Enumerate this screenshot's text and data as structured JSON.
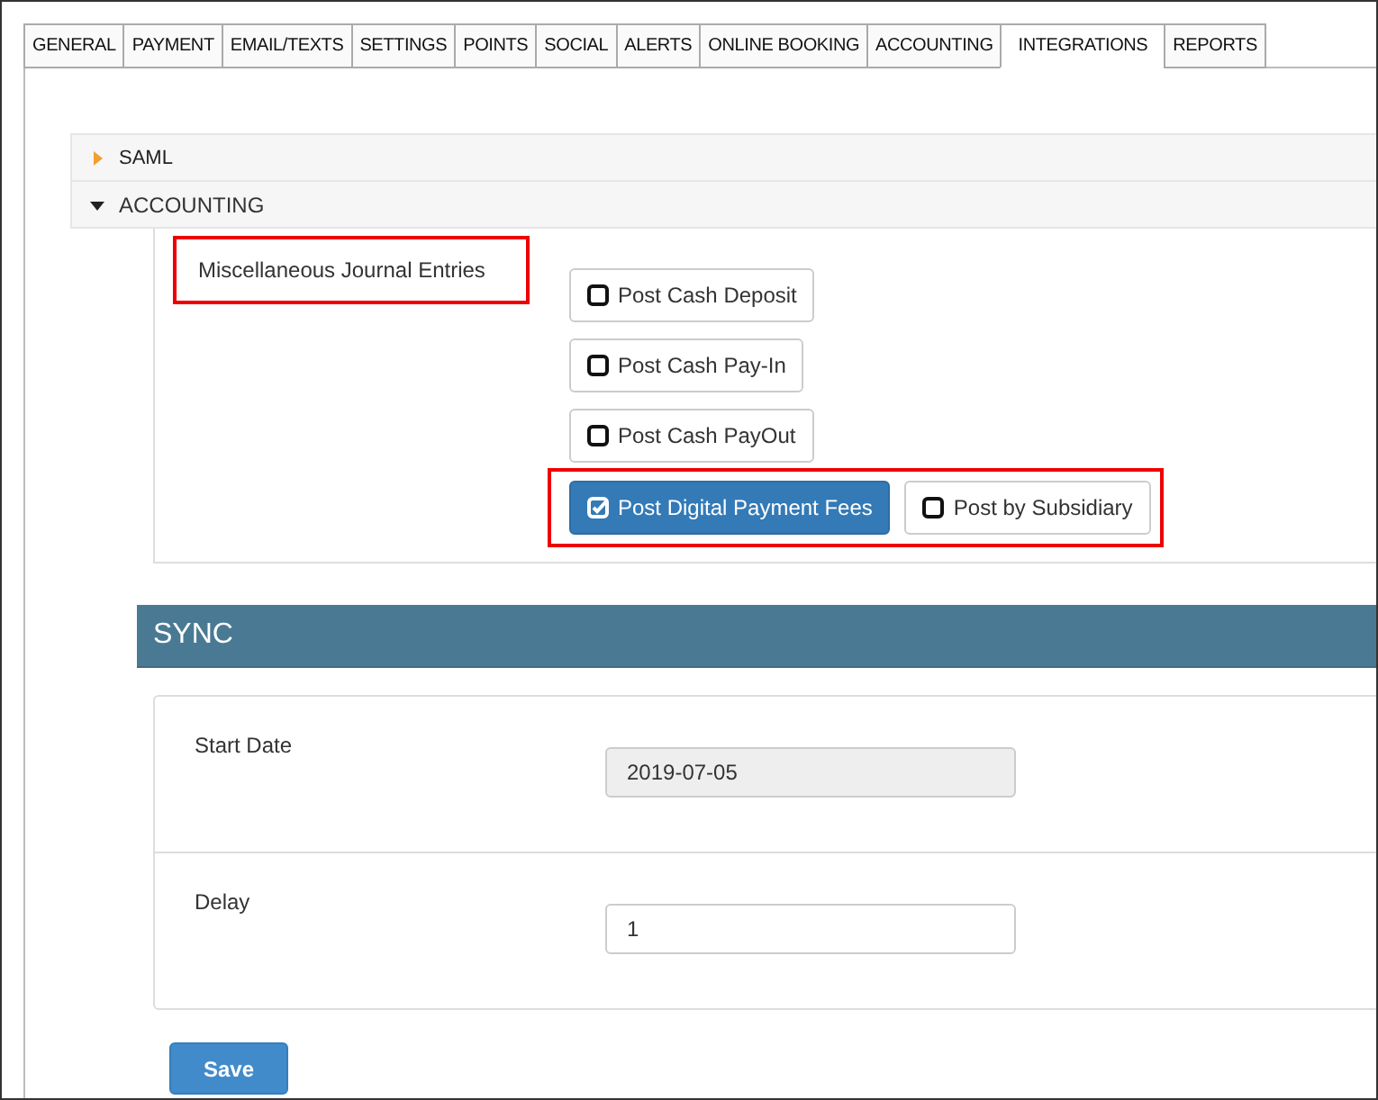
{
  "tabs": [
    {
      "label": "GENERAL",
      "selected": false
    },
    {
      "label": "PAYMENT",
      "selected": false
    },
    {
      "label": "EMAIL/TEXTS",
      "selected": false
    },
    {
      "label": "SETTINGS",
      "selected": false
    },
    {
      "label": "POINTS",
      "selected": false
    },
    {
      "label": "SOCIAL",
      "selected": false
    },
    {
      "label": "ALERTS",
      "selected": false
    },
    {
      "label": "ONLINE BOOKING",
      "selected": false
    },
    {
      "label": "ACCOUNTING",
      "selected": false
    },
    {
      "label": "INTEGRATIONS",
      "selected": true
    },
    {
      "label": "REPORTS",
      "selected": false
    }
  ],
  "accordion": [
    {
      "title": "SAML",
      "expanded": false
    },
    {
      "title": "ACCOUNTING",
      "expanded": true
    }
  ],
  "journal_entries": {
    "label": "Miscellaneous Journal Entries",
    "highlighted": true,
    "rows": [
      {
        "highlighted": false,
        "options": [
          {
            "label": "Post Cash Deposit",
            "checked": false
          }
        ]
      },
      {
        "highlighted": false,
        "options": [
          {
            "label": "Post Cash Pay-In",
            "checked": false
          }
        ]
      },
      {
        "highlighted": false,
        "options": [
          {
            "label": "Post Cash PayOut",
            "checked": false
          }
        ]
      },
      {
        "highlighted": true,
        "options": [
          {
            "label": "Post Digital Payment Fees",
            "checked": true
          },
          {
            "label": "Post by Subsidiary",
            "checked": false
          }
        ]
      }
    ]
  },
  "sync": {
    "title": "SYNC",
    "fields": [
      {
        "label": "Start Date",
        "value": "2019-07-05",
        "disabled": true
      },
      {
        "label": "Delay",
        "value": "1",
        "disabled": false
      }
    ]
  },
  "save_button": "Save"
}
